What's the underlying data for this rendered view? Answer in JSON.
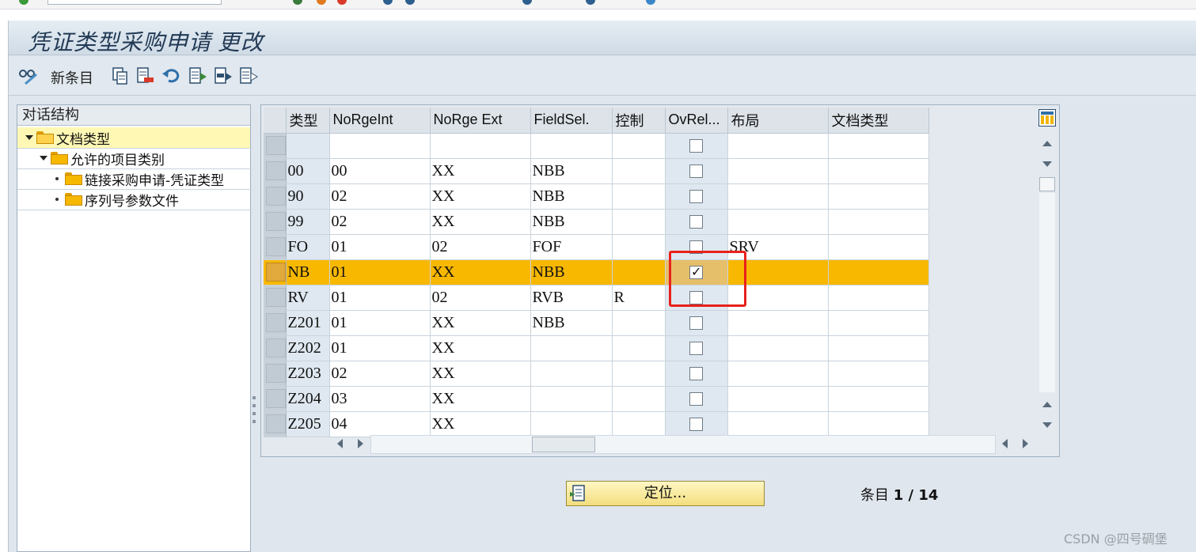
{
  "window": {
    "title": "凭证类型采购申请 更改"
  },
  "toolbar": {
    "new_entries_label": "新条目",
    "icons": [
      "glasses-pencil-icon",
      "copy-icon",
      "delete-icon",
      "undo-icon",
      "select-all-icon",
      "select-block-icon",
      "deselect-all-icon"
    ]
  },
  "tree": {
    "header": "对话结构",
    "nodes": [
      {
        "label": "文档类型",
        "level": 0,
        "expanded": true,
        "selected": true
      },
      {
        "label": "允许的项目类别",
        "level": 1,
        "expanded": true
      },
      {
        "label": "链接采购申请-凭证类型",
        "level": 2
      },
      {
        "label": "序列号参数文件",
        "level": 2
      }
    ]
  },
  "grid": {
    "columns": [
      "类型",
      "NoRgeInt",
      "NoRge Ext",
      "FieldSel.",
      "控制",
      "OvRel...",
      "布局",
      "文档类型"
    ],
    "rows": [
      {
        "type": "",
        "norge_int": "",
        "norge_ext": "",
        "fieldsel": "",
        "control": "",
        "ovrel": false,
        "layout": "",
        "doc_type": ""
      },
      {
        "type": "00",
        "norge_int": "00",
        "norge_ext": "XX",
        "fieldsel": "NBB",
        "control": "",
        "ovrel": false,
        "layout": "",
        "doc_type": ""
      },
      {
        "type": "90",
        "norge_int": "02",
        "norge_ext": "XX",
        "fieldsel": "NBB",
        "control": "",
        "ovrel": false,
        "layout": "",
        "doc_type": ""
      },
      {
        "type": "99",
        "norge_int": "02",
        "norge_ext": "XX",
        "fieldsel": "NBB",
        "control": "",
        "ovrel": false,
        "layout": "",
        "doc_type": ""
      },
      {
        "type": "FO",
        "norge_int": "01",
        "norge_ext": "02",
        "fieldsel": "FOF",
        "control": "",
        "ovrel": false,
        "layout": "SRV",
        "doc_type": ""
      },
      {
        "type": "NB",
        "norge_int": "01",
        "norge_ext": "XX",
        "fieldsel": "NBB",
        "control": "",
        "ovrel": true,
        "layout": "",
        "doc_type": "",
        "highlighted": true
      },
      {
        "type": "RV",
        "norge_int": "01",
        "norge_ext": "02",
        "fieldsel": "RVB",
        "control": "R",
        "ovrel": false,
        "layout": "",
        "doc_type": ""
      },
      {
        "type": "Z201",
        "norge_int": "01",
        "norge_ext": "XX",
        "fieldsel": "NBB",
        "control": "",
        "ovrel": false,
        "layout": "",
        "doc_type": ""
      },
      {
        "type": "Z202",
        "norge_int": "01",
        "norge_ext": "XX",
        "fieldsel": "",
        "control": "",
        "ovrel": false,
        "layout": "",
        "doc_type": ""
      },
      {
        "type": "Z203",
        "norge_int": "02",
        "norge_ext": "XX",
        "fieldsel": "",
        "control": "",
        "ovrel": false,
        "layout": "",
        "doc_type": ""
      },
      {
        "type": "Z204",
        "norge_int": "03",
        "norge_ext": "XX",
        "fieldsel": "",
        "control": "",
        "ovrel": false,
        "layout": "",
        "doc_type": ""
      },
      {
        "type": "Z205",
        "norge_int": "04",
        "norge_ext": "XX",
        "fieldsel": "",
        "control": "",
        "ovrel": false,
        "layout": "",
        "doc_type": ""
      }
    ]
  },
  "footer": {
    "locate_button": "定位...",
    "entry_label": "条目",
    "entry_value": "1 / 14"
  },
  "watermark": "CSDN @四号碉堡",
  "colors": {
    "highlight_row": "#f8b800",
    "annotation_box": "#e8211b",
    "title_text": "#223a55"
  }
}
